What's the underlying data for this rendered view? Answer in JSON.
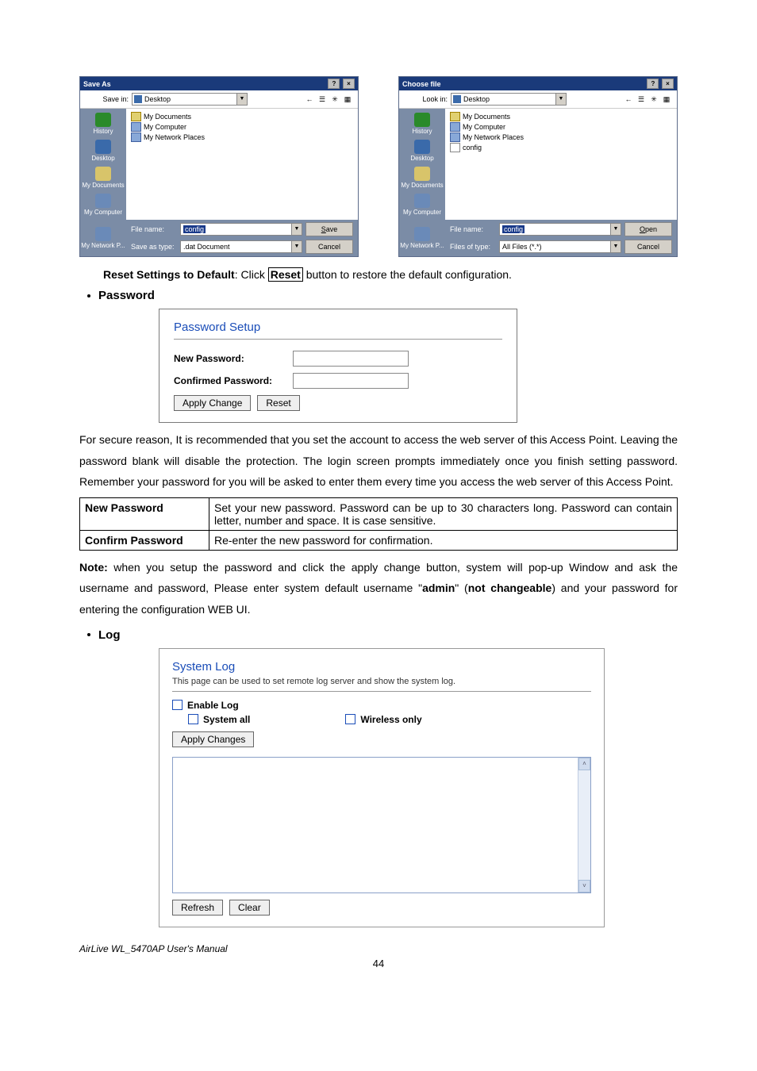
{
  "dialog_save": {
    "title": "Save As",
    "savein_label": "Save in:",
    "savein_value": "Desktop",
    "files": [
      "My Documents",
      "My Computer",
      "My Network Places"
    ],
    "filename_label": "File name:",
    "filename_value": "config",
    "saveastype_label": "Save as type:",
    "saveastype_value": ".dat Document",
    "btn_primary": "Save",
    "btn_cancel": "Cancel"
  },
  "dialog_open": {
    "title": "Choose file",
    "lookin_label": "Look in:",
    "lookin_value": "Desktop",
    "files": [
      "My Documents",
      "My Computer",
      "My Network Places",
      "config"
    ],
    "filename_label": "File name:",
    "filename_value": "config",
    "filesoftype_label": "Files of type:",
    "filesoftype_value": "All Files (*.*)",
    "btn_primary": "Open",
    "btn_cancel": "Cancel"
  },
  "places": {
    "history": "History",
    "desktop": "Desktop",
    "mydocs": "My Documents",
    "mycomp": "My Computer",
    "mynet": "My Network P..."
  },
  "reset_line": {
    "prefix_bold": "Reset Settings to Default",
    "middle": ": Click ",
    "button_text": "Reset",
    "suffix": " button to restore the default configuration."
  },
  "section_password": {
    "heading": "Password",
    "panel_title": "Password Setup",
    "new_pw_label": "New Password:",
    "conf_pw_label": "Confirmed Password:",
    "btn_apply": "Apply Change",
    "btn_reset": "Reset"
  },
  "para1": "For secure reason, It is recommended that you set the account to access the web server of this Access Point. Leaving the password blank will disable the protection. The login screen prompts immediately once you finish setting password. Remember your password for you will be asked to enter them every time you access the web server of this Access Point.",
  "def_table": {
    "rows": [
      {
        "key": "New Password",
        "val": "Set your new password. Password can be up to 30 characters long. Password can contain letter, number and space. It is case sensitive."
      },
      {
        "key": "Confirm Password",
        "val": "Re-enter the new password for confirmation."
      }
    ]
  },
  "note_line": {
    "prefix": "Note:",
    "body1": " when you setup the password and click the apply change button, system will pop-up Window and ask the username and password, Please enter system default username \"",
    "admin": "admin",
    "body2": "\" (",
    "nc": "not changeable",
    "body3": ") and your password for entering the configuration WEB UI."
  },
  "section_log": {
    "heading": "Log",
    "panel_title": "System Log",
    "subtitle": "This page can be used to set remote log server and show the system log.",
    "chk_enable": "Enable Log",
    "chk_system_all": "System all",
    "chk_wireless": "Wireless only",
    "btn_apply": "Apply Changes",
    "btn_refresh": "Refresh",
    "btn_clear": "Clear"
  },
  "footer": "AirLive WL_5470AP User's Manual",
  "pageno": "44"
}
